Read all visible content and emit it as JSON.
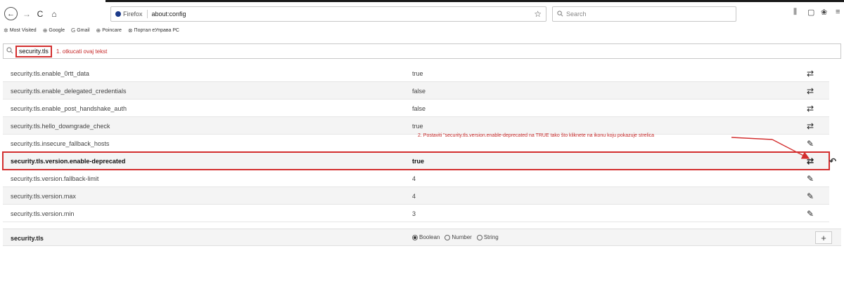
{
  "toolbar": {
    "back_icon": "←",
    "forward_icon": "→",
    "reload_icon": "C",
    "home_icon": "⌂",
    "identity_label": "Firefox",
    "url": "about:config",
    "star_icon": "☆",
    "search_placeholder": "Search",
    "library_icon": "⫼",
    "sidebar_icon": "▢",
    "extension_icon": "❀",
    "menu_icon": "≡"
  },
  "bookmarks": [
    {
      "icon": "✲",
      "label": "Most Visited"
    },
    {
      "icon": "⊕",
      "label": "Google"
    },
    {
      "icon": "G",
      "label": "Gmail"
    },
    {
      "icon": "⊕",
      "label": "Poincare"
    },
    {
      "icon": "⊗",
      "label": "Портал еУправа РС"
    }
  ],
  "config_search": {
    "value": "security.tls",
    "annotation": "1. otkucati ovaj tekst"
  },
  "prefs": [
    {
      "name": "security.tls.enable_0rtt_data",
      "value": "true",
      "action": "⇄"
    },
    {
      "name": "security.tls.enable_delegated_credentials",
      "value": "false",
      "action": "⇄"
    },
    {
      "name": "security.tls.enable_post_handshake_auth",
      "value": "false",
      "action": "⇄"
    },
    {
      "name": "security.tls.hello_downgrade_check",
      "value": "true",
      "action": "⇄"
    },
    {
      "name": "security.tls.insecure_fallback_hosts",
      "value": "",
      "action": "✎"
    },
    {
      "name": "security.tls.version.enable-deprecated",
      "value": "true",
      "action": "⇄",
      "reset": "↶"
    },
    {
      "name": "security.tls.version.fallback-limit",
      "value": "4",
      "action": "✎"
    },
    {
      "name": "security.tls.version.max",
      "value": "4",
      "action": "✎"
    },
    {
      "name": "security.tls.version.min",
      "value": "3",
      "action": "✎"
    }
  ],
  "annotation2": "2. Postaviti \"security.tls.version.enable-deprecated na TRUE tako što kliknete na ikonu koju pokazuje strelica",
  "add_row": {
    "name": "security.tls",
    "types": [
      "Boolean",
      "Number",
      "String"
    ],
    "selected": "Boolean",
    "add_icon": "+"
  },
  "accent": "#d32f2f"
}
